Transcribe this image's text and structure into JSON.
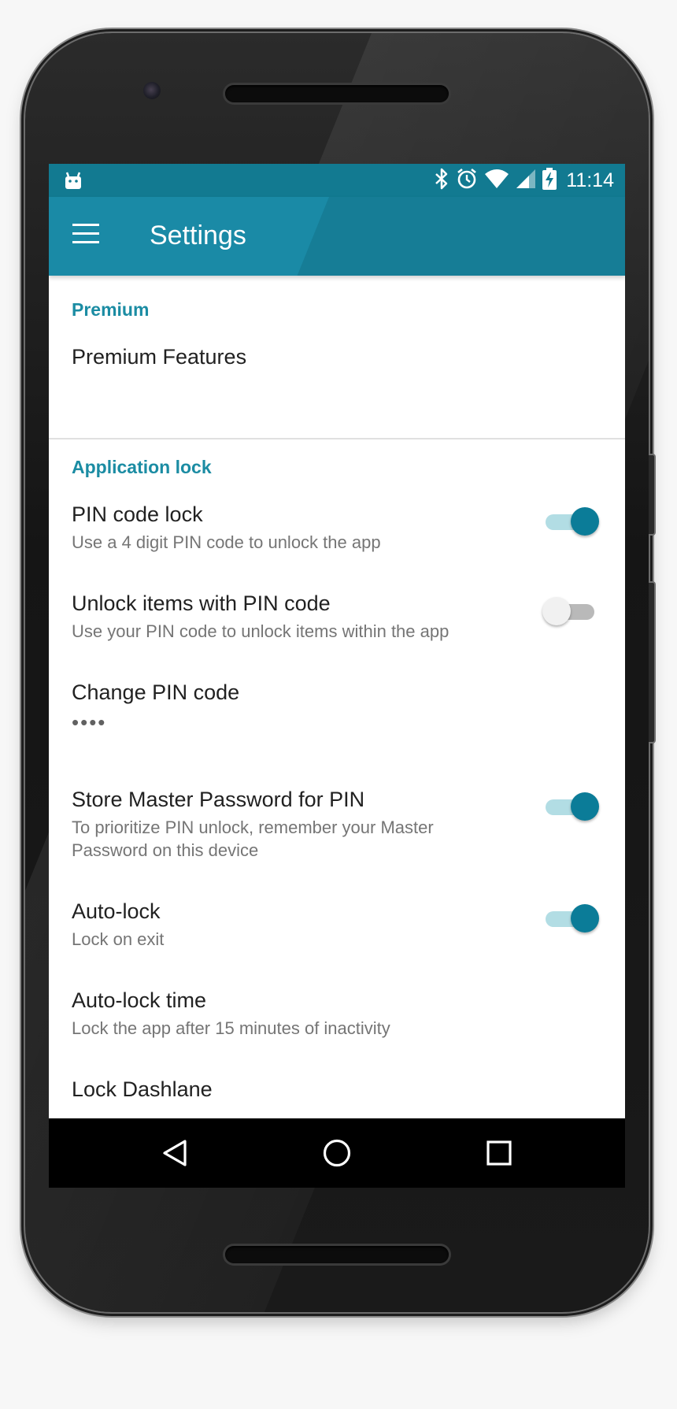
{
  "status_bar": {
    "time": "11:14",
    "icons": [
      "android-notification-icon",
      "bluetooth-icon",
      "alarm-icon",
      "wifi-icon",
      "signal-icon",
      "battery-charging-icon"
    ]
  },
  "app_bar": {
    "title": "Settings",
    "menu_icon": "menu-icon"
  },
  "sections": {
    "premium": {
      "header": "Premium",
      "items": [
        {
          "title": "Premium Features"
        }
      ]
    },
    "application_lock": {
      "header": "Application lock",
      "items": [
        {
          "title": "PIN code lock",
          "summary": "Use a 4 digit PIN code to unlock the app",
          "switch": "on"
        },
        {
          "title": "Unlock items with PIN code",
          "summary": "Use your PIN code to unlock items within the app",
          "switch": "off"
        },
        {
          "title": "Change PIN code",
          "summary": "••••"
        },
        {
          "title": "Store Master Password for PIN",
          "summary": "To prioritize PIN unlock, remember your Master Password on this device",
          "switch": "on"
        },
        {
          "title": "Auto-lock",
          "summary": "Lock on exit",
          "switch": "on"
        },
        {
          "title": "Auto-lock time",
          "summary": "Lock the app after 15 minutes of inactivity"
        },
        {
          "title": "Lock Dashlane"
        }
      ]
    }
  },
  "nav_bar": {
    "buttons": [
      "back-icon",
      "home-icon",
      "recents-icon"
    ]
  },
  "colors": {
    "app_bar": "#1a8aa6",
    "status_bar": "#127a91",
    "accent": "#1b8ca3",
    "switch_on_thumb": "#0b7c98",
    "switch_on_track": "#b2dde4"
  }
}
